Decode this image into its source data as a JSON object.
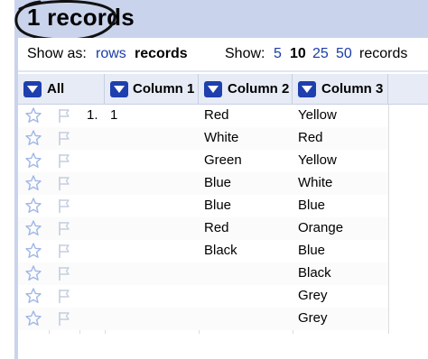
{
  "title": "1 records",
  "show_as": {
    "label": "Show as:",
    "rows": "rows",
    "records": "records"
  },
  "show": {
    "label": "Show:",
    "options": [
      "5",
      "10",
      "25",
      "50"
    ],
    "selected": "10",
    "suffix": "records"
  },
  "columns": [
    "All",
    "Column 1",
    "Column 2",
    "Column 3"
  ],
  "rows": [
    {
      "num": "1.",
      "c1": "1",
      "c2": "Red",
      "c3": "Yellow"
    },
    {
      "num": "",
      "c1": "",
      "c2": "White",
      "c3": "Red"
    },
    {
      "num": "",
      "c1": "",
      "c2": "Green",
      "c3": "Yellow"
    },
    {
      "num": "",
      "c1": "",
      "c2": "Blue",
      "c3": "White"
    },
    {
      "num": "",
      "c1": "",
      "c2": "Blue",
      "c3": "Blue"
    },
    {
      "num": "",
      "c1": "",
      "c2": "Red",
      "c3": "Orange"
    },
    {
      "num": "",
      "c1": "",
      "c2": "Black",
      "c3": "Blue"
    },
    {
      "num": "",
      "c1": "",
      "c2": "",
      "c3": "Black"
    },
    {
      "num": "",
      "c1": "",
      "c2": "",
      "c3": "Grey"
    },
    {
      "num": "",
      "c1": "",
      "c2": "",
      "c3": "Grey"
    }
  ],
  "colors": {
    "accent": "#1e3fae",
    "link": "#1a3da8",
    "title_bg": "#c9d3ec",
    "header_bg": "#e6ebf6"
  },
  "icons": {
    "star": "star-icon",
    "flag": "flag-icon",
    "dropdown": "dropdown-arrow-icon"
  }
}
